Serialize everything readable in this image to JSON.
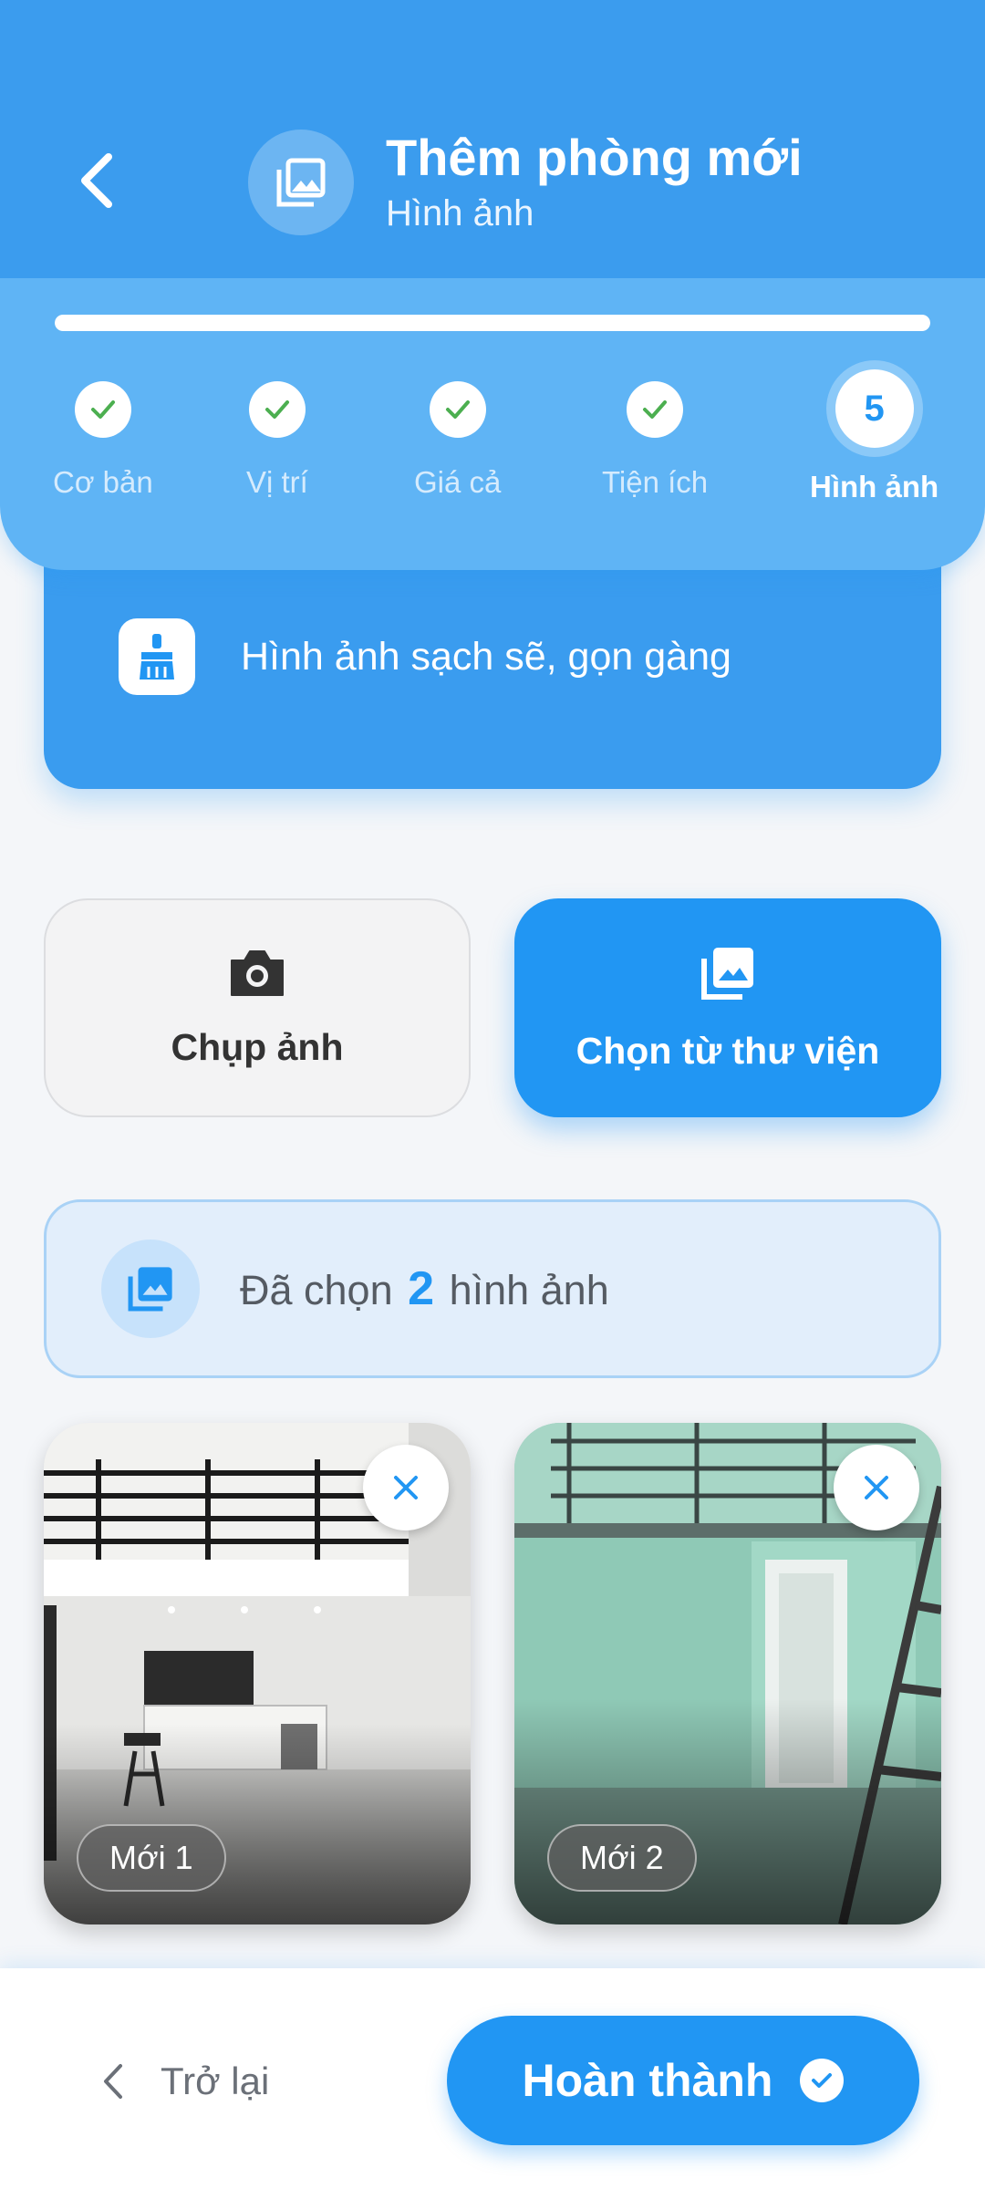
{
  "header": {
    "title": "Thêm phòng mới",
    "subtitle": "Hình ảnh",
    "back_icon": "chevron-left-icon",
    "avatar_icon": "photo-library-icon"
  },
  "progress": {
    "fraction": 1.0,
    "steps": [
      {
        "label": "Cơ bản",
        "status": "done"
      },
      {
        "label": "Vị trí",
        "status": "done"
      },
      {
        "label": "Giá cả",
        "status": "done"
      },
      {
        "label": "Tiện ích",
        "status": "done"
      },
      {
        "label": "Hình ảnh",
        "status": "active",
        "number": "5"
      }
    ]
  },
  "tips": {
    "visible_item": "Hình ảnh sạch sẽ, gọn gàng",
    "visible_item_icon": "brush-icon"
  },
  "actions": {
    "camera_label": "Chụp ảnh",
    "camera_icon": "camera-icon",
    "gallery_label": "Chọn từ thư viện",
    "gallery_icon": "photo-library-icon"
  },
  "selection": {
    "prefix": "Đã chọn",
    "count": "2",
    "suffix": "hình ảnh"
  },
  "photos": [
    {
      "badge": "Mới 1",
      "remove_icon": "close-icon"
    },
    {
      "badge": "Mới 2",
      "remove_icon": "close-icon"
    }
  ],
  "footer": {
    "back_label": "Trở lại",
    "finish_label": "Hoàn thành",
    "finish_icon": "check-circle-icon"
  },
  "colors": {
    "primary": "#2196f3",
    "header": "#3b9cee",
    "header_light": "#5fb4f5",
    "step_check": "#4caf50"
  }
}
